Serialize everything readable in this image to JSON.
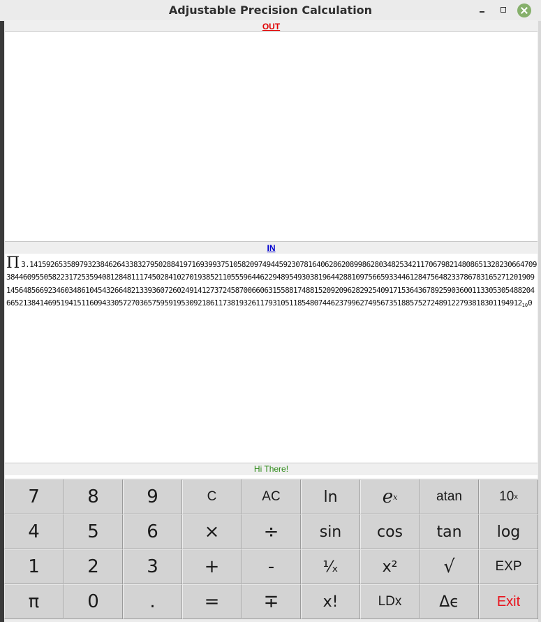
{
  "window": {
    "title": "Adjustable Precision Calculation"
  },
  "sections": {
    "out_label": "OUT",
    "in_label": "IN",
    "status": "Hi There!"
  },
  "input": {
    "pi_symbol": "Π",
    "value": "3.14159265358979323846264338327950288419716939937510582097494459230781640628620899862803482534211706798214808651328230664709384460955058223172535940812848111745028410270193852110555964462294895493038196442881097566593344612847564823378678316527120190914564856692346034861045432664821339360726024914127372458700660631558817488152092096282925409171536436789259036001133053054882046652138414695194151160943305727036575959195309218611738193261179310511854807446237996274956735188575272489122793818301194912",
    "exp_base": "10",
    "exp_value": "0"
  },
  "keypad": {
    "keys": [
      {
        "label": "7"
      },
      {
        "label": "8"
      },
      {
        "label": "9"
      },
      {
        "label": "C"
      },
      {
        "label": "AC"
      },
      {
        "label": "ln"
      },
      {
        "label": "e",
        "sup": "x"
      },
      {
        "label": "atan"
      },
      {
        "label": "10",
        "sup": "x"
      },
      {
        "label": "4"
      },
      {
        "label": "5"
      },
      {
        "label": "6"
      },
      {
        "label": "×"
      },
      {
        "label": "÷"
      },
      {
        "label": "sin"
      },
      {
        "label": "cos"
      },
      {
        "label": "tan"
      },
      {
        "label": "log"
      },
      {
        "label": "1"
      },
      {
        "label": "2"
      },
      {
        "label": "3"
      },
      {
        "label": "+"
      },
      {
        "label": "-"
      },
      {
        "label": "¹⁄ₓ"
      },
      {
        "label": "x²"
      },
      {
        "label": "√"
      },
      {
        "label": "EXP"
      },
      {
        "label": "π"
      },
      {
        "label": "0"
      },
      {
        "label": "."
      },
      {
        "label": "="
      },
      {
        "label": "∓"
      },
      {
        "label": "x!"
      },
      {
        "label": "LDx"
      },
      {
        "label": "Δϵ"
      },
      {
        "label": "Exit"
      }
    ]
  }
}
